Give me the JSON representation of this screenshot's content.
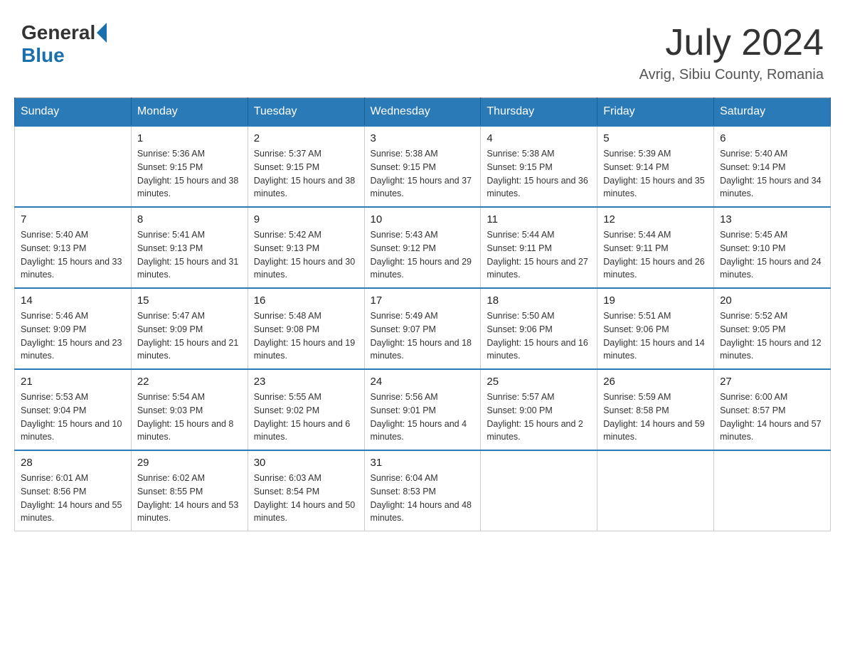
{
  "header": {
    "logo": {
      "text_general": "General",
      "text_blue": "Blue",
      "alt": "GeneralBlue logo"
    },
    "month_title": "July 2024",
    "location": "Avrig, Sibiu County, Romania"
  },
  "calendar": {
    "days_of_week": [
      "Sunday",
      "Monday",
      "Tuesday",
      "Wednesday",
      "Thursday",
      "Friday",
      "Saturday"
    ],
    "weeks": [
      [
        {
          "day": "",
          "sunrise": "",
          "sunset": "",
          "daylight": ""
        },
        {
          "day": "1",
          "sunrise": "Sunrise: 5:36 AM",
          "sunset": "Sunset: 9:15 PM",
          "daylight": "Daylight: 15 hours and 38 minutes."
        },
        {
          "day": "2",
          "sunrise": "Sunrise: 5:37 AM",
          "sunset": "Sunset: 9:15 PM",
          "daylight": "Daylight: 15 hours and 38 minutes."
        },
        {
          "day": "3",
          "sunrise": "Sunrise: 5:38 AM",
          "sunset": "Sunset: 9:15 PM",
          "daylight": "Daylight: 15 hours and 37 minutes."
        },
        {
          "day": "4",
          "sunrise": "Sunrise: 5:38 AM",
          "sunset": "Sunset: 9:15 PM",
          "daylight": "Daylight: 15 hours and 36 minutes."
        },
        {
          "day": "5",
          "sunrise": "Sunrise: 5:39 AM",
          "sunset": "Sunset: 9:14 PM",
          "daylight": "Daylight: 15 hours and 35 minutes."
        },
        {
          "day": "6",
          "sunrise": "Sunrise: 5:40 AM",
          "sunset": "Sunset: 9:14 PM",
          "daylight": "Daylight: 15 hours and 34 minutes."
        }
      ],
      [
        {
          "day": "7",
          "sunrise": "Sunrise: 5:40 AM",
          "sunset": "Sunset: 9:13 PM",
          "daylight": "Daylight: 15 hours and 33 minutes."
        },
        {
          "day": "8",
          "sunrise": "Sunrise: 5:41 AM",
          "sunset": "Sunset: 9:13 PM",
          "daylight": "Daylight: 15 hours and 31 minutes."
        },
        {
          "day": "9",
          "sunrise": "Sunrise: 5:42 AM",
          "sunset": "Sunset: 9:13 PM",
          "daylight": "Daylight: 15 hours and 30 minutes."
        },
        {
          "day": "10",
          "sunrise": "Sunrise: 5:43 AM",
          "sunset": "Sunset: 9:12 PM",
          "daylight": "Daylight: 15 hours and 29 minutes."
        },
        {
          "day": "11",
          "sunrise": "Sunrise: 5:44 AM",
          "sunset": "Sunset: 9:11 PM",
          "daylight": "Daylight: 15 hours and 27 minutes."
        },
        {
          "day": "12",
          "sunrise": "Sunrise: 5:44 AM",
          "sunset": "Sunset: 9:11 PM",
          "daylight": "Daylight: 15 hours and 26 minutes."
        },
        {
          "day": "13",
          "sunrise": "Sunrise: 5:45 AM",
          "sunset": "Sunset: 9:10 PM",
          "daylight": "Daylight: 15 hours and 24 minutes."
        }
      ],
      [
        {
          "day": "14",
          "sunrise": "Sunrise: 5:46 AM",
          "sunset": "Sunset: 9:09 PM",
          "daylight": "Daylight: 15 hours and 23 minutes."
        },
        {
          "day": "15",
          "sunrise": "Sunrise: 5:47 AM",
          "sunset": "Sunset: 9:09 PM",
          "daylight": "Daylight: 15 hours and 21 minutes."
        },
        {
          "day": "16",
          "sunrise": "Sunrise: 5:48 AM",
          "sunset": "Sunset: 9:08 PM",
          "daylight": "Daylight: 15 hours and 19 minutes."
        },
        {
          "day": "17",
          "sunrise": "Sunrise: 5:49 AM",
          "sunset": "Sunset: 9:07 PM",
          "daylight": "Daylight: 15 hours and 18 minutes."
        },
        {
          "day": "18",
          "sunrise": "Sunrise: 5:50 AM",
          "sunset": "Sunset: 9:06 PM",
          "daylight": "Daylight: 15 hours and 16 minutes."
        },
        {
          "day": "19",
          "sunrise": "Sunrise: 5:51 AM",
          "sunset": "Sunset: 9:06 PM",
          "daylight": "Daylight: 15 hours and 14 minutes."
        },
        {
          "day": "20",
          "sunrise": "Sunrise: 5:52 AM",
          "sunset": "Sunset: 9:05 PM",
          "daylight": "Daylight: 15 hours and 12 minutes."
        }
      ],
      [
        {
          "day": "21",
          "sunrise": "Sunrise: 5:53 AM",
          "sunset": "Sunset: 9:04 PM",
          "daylight": "Daylight: 15 hours and 10 minutes."
        },
        {
          "day": "22",
          "sunrise": "Sunrise: 5:54 AM",
          "sunset": "Sunset: 9:03 PM",
          "daylight": "Daylight: 15 hours and 8 minutes."
        },
        {
          "day": "23",
          "sunrise": "Sunrise: 5:55 AM",
          "sunset": "Sunset: 9:02 PM",
          "daylight": "Daylight: 15 hours and 6 minutes."
        },
        {
          "day": "24",
          "sunrise": "Sunrise: 5:56 AM",
          "sunset": "Sunset: 9:01 PM",
          "daylight": "Daylight: 15 hours and 4 minutes."
        },
        {
          "day": "25",
          "sunrise": "Sunrise: 5:57 AM",
          "sunset": "Sunset: 9:00 PM",
          "daylight": "Daylight: 15 hours and 2 minutes."
        },
        {
          "day": "26",
          "sunrise": "Sunrise: 5:59 AM",
          "sunset": "Sunset: 8:58 PM",
          "daylight": "Daylight: 14 hours and 59 minutes."
        },
        {
          "day": "27",
          "sunrise": "Sunrise: 6:00 AM",
          "sunset": "Sunset: 8:57 PM",
          "daylight": "Daylight: 14 hours and 57 minutes."
        }
      ],
      [
        {
          "day": "28",
          "sunrise": "Sunrise: 6:01 AM",
          "sunset": "Sunset: 8:56 PM",
          "daylight": "Daylight: 14 hours and 55 minutes."
        },
        {
          "day": "29",
          "sunrise": "Sunrise: 6:02 AM",
          "sunset": "Sunset: 8:55 PM",
          "daylight": "Daylight: 14 hours and 53 minutes."
        },
        {
          "day": "30",
          "sunrise": "Sunrise: 6:03 AM",
          "sunset": "Sunset: 8:54 PM",
          "daylight": "Daylight: 14 hours and 50 minutes."
        },
        {
          "day": "31",
          "sunrise": "Sunrise: 6:04 AM",
          "sunset": "Sunset: 8:53 PM",
          "daylight": "Daylight: 14 hours and 48 minutes."
        },
        {
          "day": "",
          "sunrise": "",
          "sunset": "",
          "daylight": ""
        },
        {
          "day": "",
          "sunrise": "",
          "sunset": "",
          "daylight": ""
        },
        {
          "day": "",
          "sunrise": "",
          "sunset": "",
          "daylight": ""
        }
      ]
    ]
  }
}
